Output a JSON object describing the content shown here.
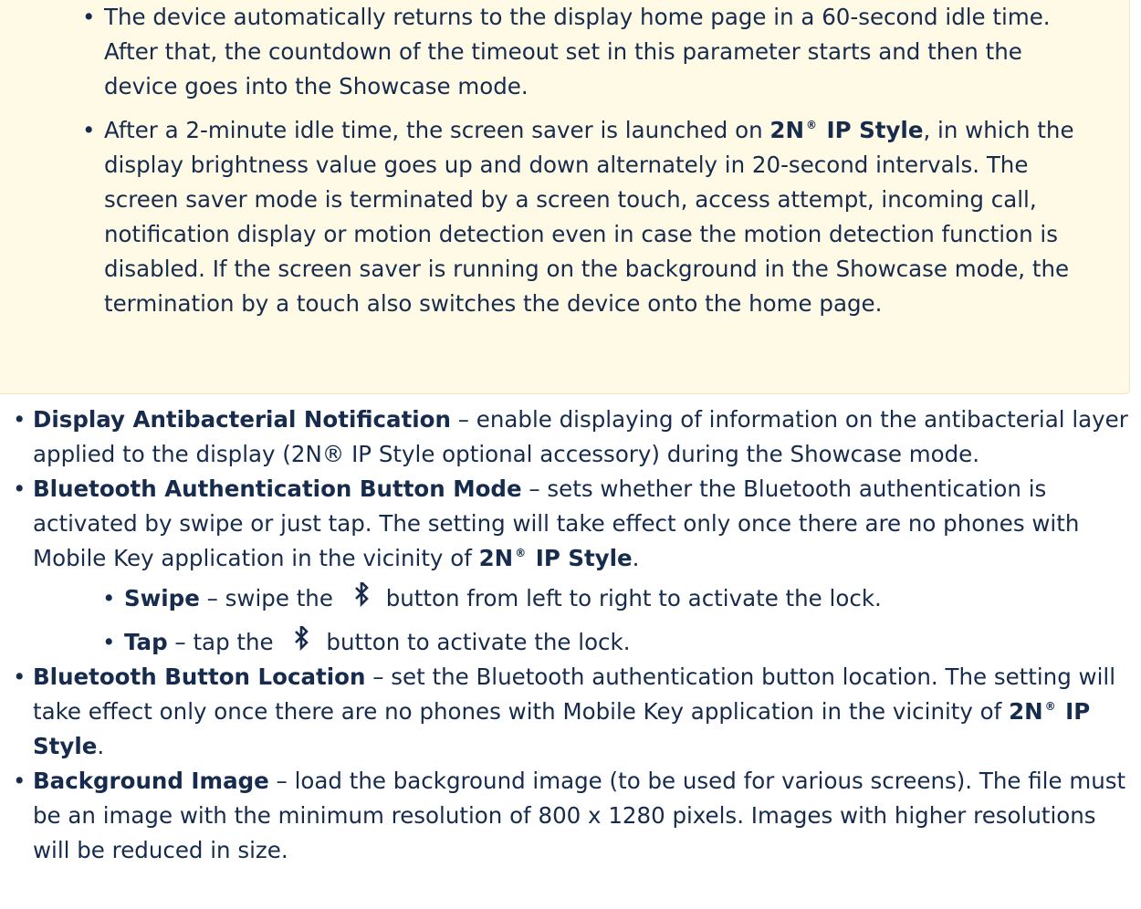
{
  "note": {
    "item1": "The device automatically returns to the display home page in a 60-second idle time. After that, the countdown of the timeout set in this parameter starts and then the device goes into the Showcase mode.",
    "item2": {
      "pre": "After a 2-minute idle time, the screen saver is launched on",
      "brand_a": "2N",
      "reg": "®",
      "brand_b": "IP Style",
      "post": ", in which the display brightness value goes up and down alternately in 20-second intervals. The screen saver mode is terminated by a screen touch, access attempt, incoming call, notification display or motion detection even in case the motion detection function is disabled. If the screen saver is running on the background in the Showcase mode, the termination by a touch also switches the device onto the home page."
    }
  },
  "params": {
    "antibacterial": {
      "term": "Display Antibacterial Notification",
      "desc": " – enable displaying of information on the antibacterial layer applied to the display (2N® IP Style optional accessory) during the Showcase mode."
    },
    "bt_mode": {
      "term": "Bluetooth Authentication Button Mode",
      "desc": " – sets whether the Bluetooth authentication is activated by swipe or just tap. The setting will take effect only once there are no phones with Mobile Key application in the vicinity of ",
      "brand_a": "2N",
      "reg": "®",
      "brand_b": "IP Style",
      "end": ".",
      "options": {
        "swipe_term": "Swipe",
        "swipe_pre": " – swipe the ",
        "swipe_post": "button from left to right to activate the lock.",
        "tap_term": "Tap",
        "tap_pre": " – tap the ",
        "tap_post": "button to activate the lock."
      }
    },
    "bt_location": {
      "term": "Bluetooth Button Location",
      "desc": " – set the Bluetooth authentication button location. The setting will take effect only once there are no phones with Mobile Key application in the vicinity of ",
      "brand_a": "2N",
      "reg": "®",
      "brand_b": "IP Style",
      "end": "."
    },
    "background": {
      "term": "Background Image",
      "desc": " – load the background image (to be used for various screens). The file must be an image with the minimum resolution of 800 x 1280 pixels. Images with higher resolutions will be reduced in size."
    }
  },
  "icons": {
    "bluetooth": "bluetooth-icon"
  },
  "colors": {
    "note_bg": "#fffae6",
    "text": "#172b4d"
  }
}
